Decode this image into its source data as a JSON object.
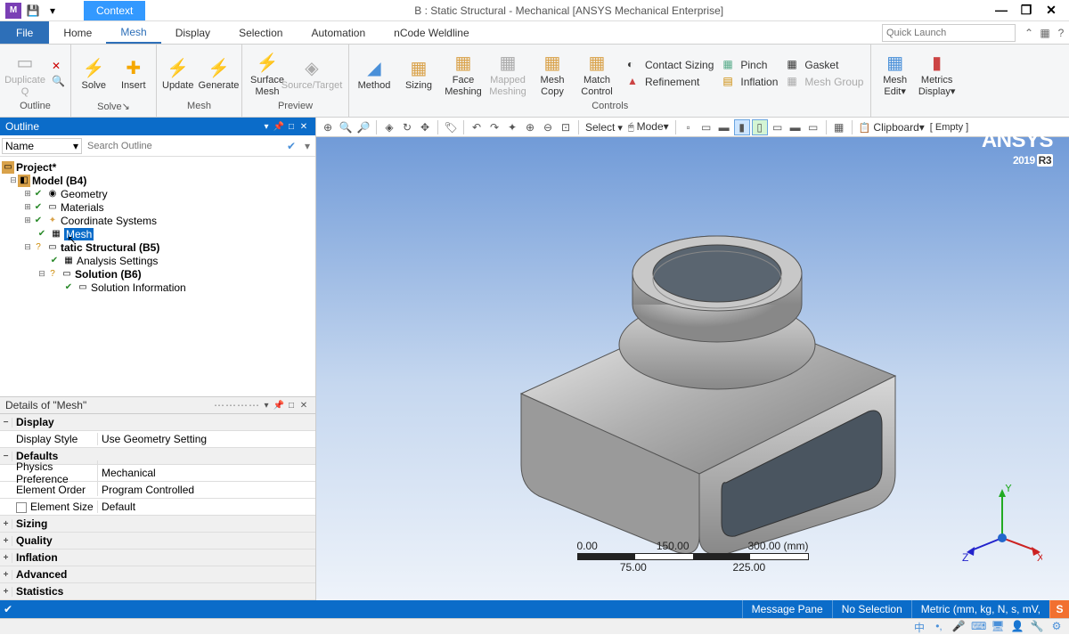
{
  "window": {
    "title": "B : Static Structural - Mechanical [ANSYS Mechanical Enterprise]",
    "context_tab": "Context"
  },
  "menu": {
    "file": "File",
    "tabs": [
      "Home",
      "Mesh",
      "Display",
      "Selection",
      "Automation",
      "nCode Weldline"
    ],
    "active_tab": "Mesh",
    "quick_launch_placeholder": "Quick Launch"
  },
  "ribbon": {
    "groups": {
      "outline": {
        "label": "Outline",
        "duplicate": "Duplicate\nQ"
      },
      "solve": {
        "label": "Solve↘",
        "solve": "Solve",
        "insert": "Insert"
      },
      "mesh": {
        "label": "Mesh",
        "update": "Update",
        "generate": "Generate",
        "surface": "Surface\nMesh",
        "preview_group": "Preview",
        "source_target": "Source/Target"
      },
      "controls": {
        "label": "Controls",
        "method": "Method",
        "sizing": "Sizing",
        "face_meshing": "Face\nMeshing",
        "mapped_meshing": "Mapped\nMeshing",
        "mesh_copy": "Mesh\nCopy",
        "match_control": "Match\nControl",
        "contact_sizing": "Contact Sizing",
        "pinch": "Pinch",
        "gasket": "Gasket",
        "refinement": "Refinement",
        "inflation": "Inflation",
        "mesh_group": "Mesh Group"
      },
      "mesh_panel": {
        "mesh_edit": "Mesh\nEdit▾",
        "metrics": "Metrics\nDisplay▾"
      }
    }
  },
  "outline_panel": {
    "title": "Outline",
    "name_label": "Name",
    "search_placeholder": "Search Outline",
    "tree": {
      "project": "Project*",
      "model": "Model (B4)",
      "geometry": "Geometry",
      "materials": "Materials",
      "coord": "Coordinate Systems",
      "mesh": "Mesh",
      "static": "tatic Structural (B5)",
      "analysis": "Analysis Settings",
      "solution": "Solution (B6)",
      "sol_info": "Solution Information"
    }
  },
  "details_panel": {
    "title": "Details of \"Mesh\"",
    "categories": {
      "display": "Display",
      "defaults": "Defaults",
      "sizing": "Sizing",
      "quality": "Quality",
      "inflation": "Inflation",
      "advanced": "Advanced",
      "statistics": "Statistics"
    },
    "rows": {
      "display_style": {
        "k": "Display Style",
        "v": "Use Geometry Setting"
      },
      "physics_pref": {
        "k": "Physics Preference",
        "v": "Mechanical"
      },
      "element_order": {
        "k": "Element Order",
        "v": "Program Controlled"
      },
      "element_size": {
        "k": "Element Size",
        "v": "Default"
      }
    }
  },
  "view_toolbar": {
    "select": "Select",
    "mode": "Mode▾",
    "clipboard": "Clipboard▾",
    "empty": "[ Empty ]"
  },
  "brand": {
    "name": "ANSYS",
    "year": "2019",
    "release": "R3"
  },
  "scalebar": {
    "ticks_top": [
      "0.00",
      "150.00",
      "300.00 (mm)"
    ],
    "ticks_bottom": [
      "75.00",
      "225.00"
    ]
  },
  "triad": {
    "x": "X",
    "y": "Y",
    "z": "Z"
  },
  "statusbar": {
    "message_pane": "Message Pane",
    "no_selection": "No Selection",
    "units": "Metric (mm, kg, N, s, mV,"
  },
  "input_indicator": "S"
}
